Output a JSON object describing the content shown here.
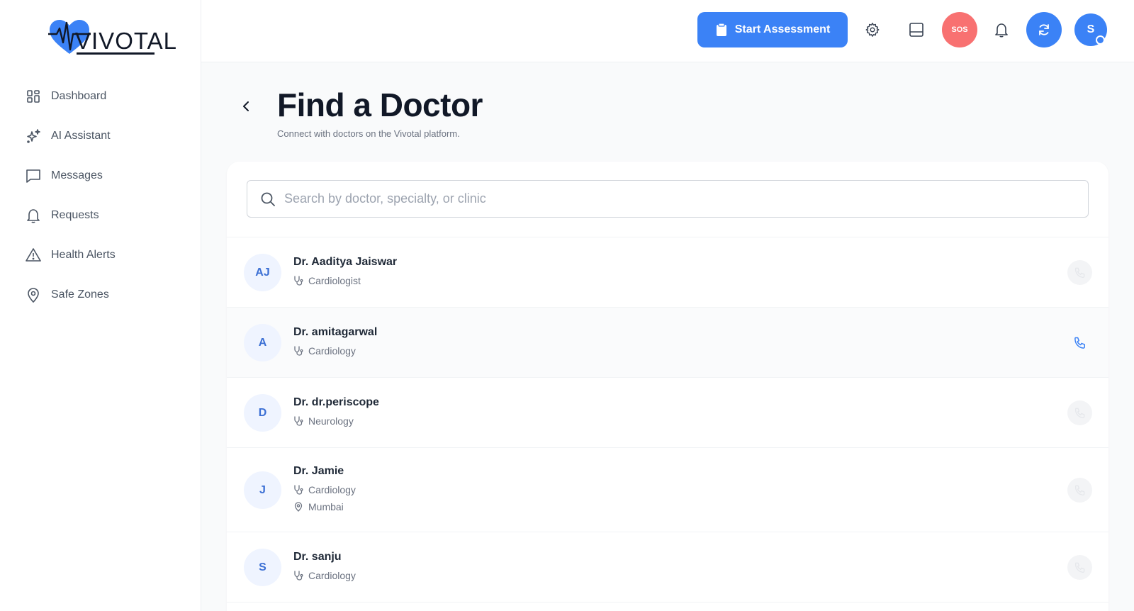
{
  "brand": {
    "name": "VIVOTAL",
    "accent": "#3b82f6"
  },
  "sidebar": {
    "items": [
      {
        "label": "Dashboard",
        "icon": "dashboard-icon"
      },
      {
        "label": "AI Assistant",
        "icon": "sparkles-icon"
      },
      {
        "label": "Messages",
        "icon": "message-icon"
      },
      {
        "label": "Requests",
        "icon": "bell-icon"
      },
      {
        "label": "Health Alerts",
        "icon": "alert-triangle-icon"
      },
      {
        "label": "Safe Zones",
        "icon": "map-pin-icon"
      }
    ]
  },
  "header": {
    "start_assessment_label": "Start Assessment",
    "sos_label": "SOS",
    "avatar_initial": "S"
  },
  "page": {
    "title": "Find a Doctor",
    "subtitle": "Connect with doctors on the Vivotal platform."
  },
  "search": {
    "placeholder": "Search by doctor, specialty, or clinic",
    "value": ""
  },
  "doctors": [
    {
      "initials": "AJ",
      "name": "Dr. Aaditya Jaiswar",
      "specialty": "Cardiologist",
      "location": "",
      "call_enabled": false
    },
    {
      "initials": "A",
      "name": "Dr. amitagarwal",
      "specialty": "Cardiology",
      "location": "",
      "call_enabled": true
    },
    {
      "initials": "D",
      "name": "Dr. dr.periscope",
      "specialty": "Neurology",
      "location": "",
      "call_enabled": false
    },
    {
      "initials": "J",
      "name": "Dr. Jamie",
      "specialty": "Cardiology",
      "location": "Mumbai",
      "call_enabled": false
    },
    {
      "initials": "S",
      "name": "Dr. sanju",
      "specialty": "Cardiology",
      "location": "",
      "call_enabled": false
    }
  ]
}
